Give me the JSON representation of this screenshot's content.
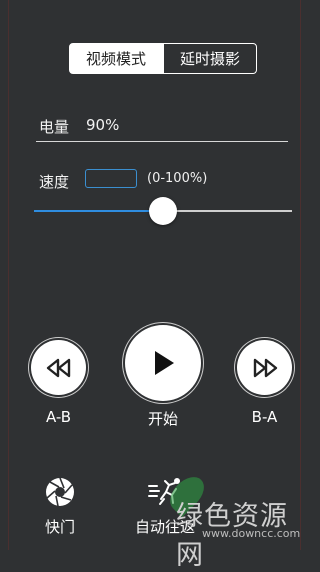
{
  "mode_tabs": [
    {
      "label": "视频模式",
      "active": true
    },
    {
      "label": "延时摄影",
      "active": false
    }
  ],
  "battery": {
    "label": "电量",
    "value": "90%"
  },
  "speed": {
    "label": "速度",
    "input_value": "",
    "range_hint": "(0-100%)",
    "slider_level": 0.5
  },
  "controls": {
    "rewind_label": "A-B",
    "play_label": "开始",
    "forward_label": "B-A"
  },
  "bottom": {
    "shutter_label": "快门",
    "auto_return_label": "自动往返"
  },
  "watermark": {
    "text": "绿色资源网",
    "url": "www.downcc.com"
  },
  "colors": {
    "background": "#2f3133",
    "accent": "#2f8de0",
    "watermark_green": "#2e9b42"
  }
}
